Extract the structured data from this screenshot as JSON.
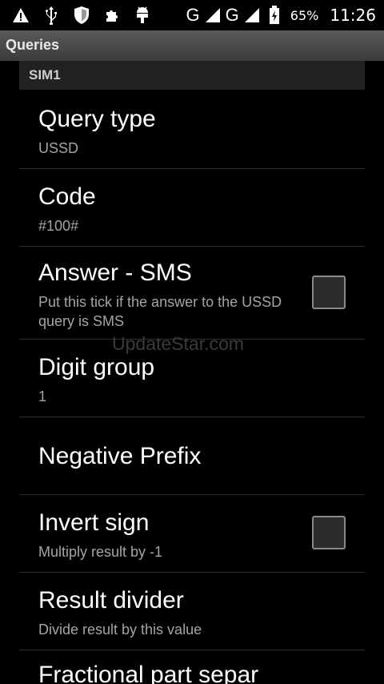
{
  "status_bar": {
    "icons_left": [
      "warning-icon",
      "usb-icon",
      "shield-icon",
      "puzzle-icon",
      "android-debug-icon"
    ],
    "network_1": "G",
    "network_2": "G",
    "battery_percent": "65%",
    "time": "11:26"
  },
  "title_bar": {
    "title": "Queries"
  },
  "section": {
    "label": "SIM1"
  },
  "items": [
    {
      "title": "Query type",
      "summary": "USSD"
    },
    {
      "title": "Code",
      "summary": "#100#"
    },
    {
      "title": "Answer - SMS",
      "summary": "Put this tick if the answer to the USSD query is SMS",
      "checked": false
    },
    {
      "title": "Digit group",
      "summary": "1"
    },
    {
      "title": "Negative Prefix"
    },
    {
      "title": "Invert sign",
      "summary": "Multiply result by -1",
      "checked": false
    },
    {
      "title": "Result divider",
      "summary": "Divide result by this value"
    },
    {
      "title": "Fractional part separ"
    }
  ],
  "watermark": "UpdateStar.com"
}
